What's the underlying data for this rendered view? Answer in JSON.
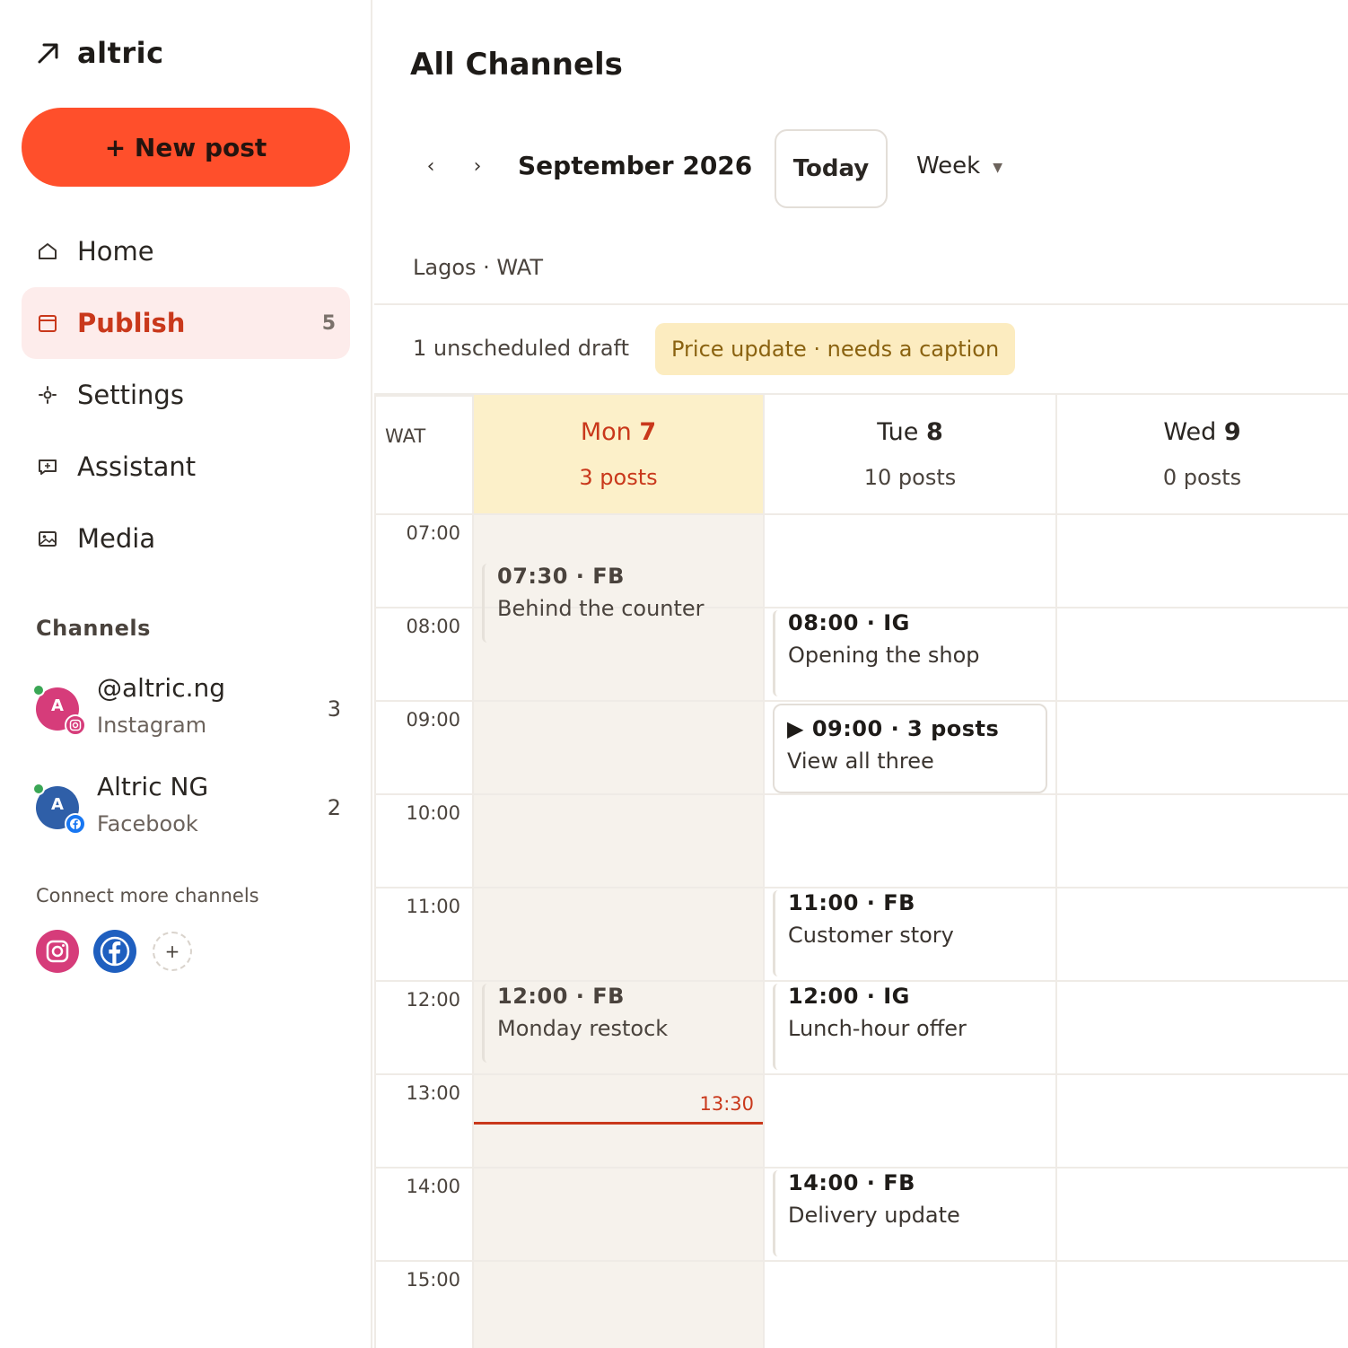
{
  "brand": {
    "name": "altric"
  },
  "sidebar": {
    "new_post_label": "+ New post",
    "nav": [
      {
        "label": "Home",
        "icon": "home-icon"
      },
      {
        "label": "Publish",
        "icon": "calendar-icon",
        "badge": "5",
        "active": true
      },
      {
        "label": "Settings",
        "icon": "gear-icon"
      },
      {
        "label": "Assistant",
        "icon": "chat-icon"
      },
      {
        "label": "Media",
        "icon": "image-icon"
      }
    ],
    "channels_title": "Channels",
    "channels": [
      {
        "name": "@altric.ng",
        "type": "Instagram",
        "count": "3",
        "avatar": "A",
        "color": "#d63c7a"
      },
      {
        "name": "Altric NG",
        "type": "Facebook",
        "count": "2",
        "avatar": "A",
        "color": "#2f5fa8"
      }
    ],
    "connect_title": "Connect more channels",
    "connect_plus": "+"
  },
  "main": {
    "title": "All Channels",
    "prev_label": "‹",
    "next_label": "›",
    "month": "September 2026",
    "today_label": "Today",
    "view_label": "Week",
    "view_caret": "▼",
    "timezone": "Lagos · WAT",
    "draft_label": "1 unscheduled draft",
    "draft_chip": "Price update · needs a caption"
  },
  "calendar": {
    "tz_short": "WAT",
    "days": [
      {
        "name": "Mon",
        "num": "7",
        "count": "3 posts",
        "today": true
      },
      {
        "name": "Tue",
        "num": "8",
        "count": "10 posts"
      },
      {
        "name": "Wed",
        "num": "9",
        "count": "0 posts"
      }
    ],
    "hours": [
      "07:00",
      "08:00",
      "09:00",
      "10:00",
      "11:00",
      "12:00",
      "13:00",
      "14:00",
      "15:00"
    ],
    "now_label": "13:30",
    "events": [
      {
        "day": 0,
        "title": "07:30 · FB",
        "sub": "Behind the counter"
      },
      {
        "day": 0,
        "title": "12:00 · FB",
        "sub": "Monday restock"
      },
      {
        "day": 1,
        "title": "08:00 · IG",
        "sub": "Opening the shop"
      },
      {
        "day": 1,
        "title": "▶ 09:00 · 3 posts",
        "sub": "View all three"
      },
      {
        "day": 1,
        "title": "11:00 · FB",
        "sub": "Customer story"
      },
      {
        "day": 1,
        "title": "12:00 · IG",
        "sub": "Lunch-hour offer"
      },
      {
        "day": 1,
        "title": "14:00 · FB",
        "sub": "Delivery update"
      }
    ]
  },
  "colors": {
    "accent": "#ff4f2b",
    "active_text": "#c9381b",
    "today_bg": "#fcf0c9",
    "draft_bg": "#fcecc0"
  }
}
